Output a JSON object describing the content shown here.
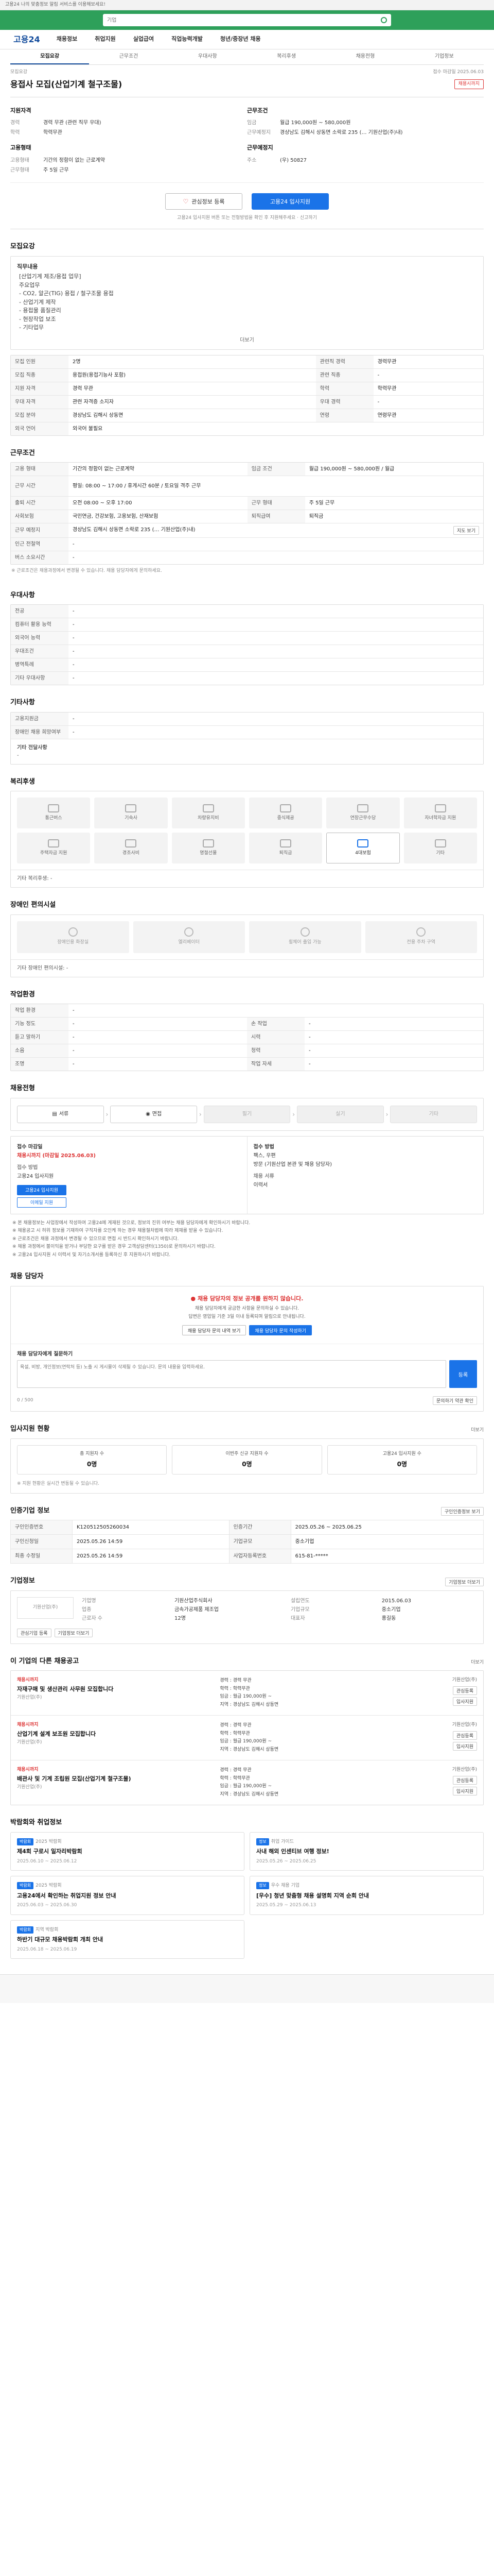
{
  "top_notice": "고용24 나의 맞춤정보 알림 서비스를 이용해보세요!",
  "search": {
    "placeholder": "기업"
  },
  "gnb": {
    "logo": "고용24",
    "items": [
      "채용정보",
      "취업지원",
      "실업급여",
      "직업능력개발",
      "청년/중장년 채용"
    ]
  },
  "tabs": [
    {
      "label": "모집요강",
      "active": true
    },
    {
      "label": "근무조건",
      "active": false
    },
    {
      "label": "우대사항",
      "active": false
    },
    {
      "label": "복리후생",
      "active": false
    },
    {
      "label": "채용전형",
      "active": false
    },
    {
      "label": "기업정보",
      "active": false
    }
  ],
  "header": {
    "meta_left": "모집요강",
    "meta_right": "접수 마감일 2025.06.03",
    "title": "용접사 모집(산업기계 철구조물)",
    "badge": "채용시까지"
  },
  "summary": {
    "left_head": "지원자격",
    "left_rows": [
      {
        "k": "경력",
        "v": "경력 무관 (관련 직무 우대)"
      },
      {
        "k": "학력",
        "v": "학력무관"
      }
    ],
    "left_head2": "고용형태",
    "left_rows2": [
      {
        "k": "고용형태",
        "v": "기간의 정함이 없는 근로계약"
      },
      {
        "k": "근무형태",
        "v": "주 5일 근무"
      }
    ],
    "right_head": "근무조건",
    "right_rows": [
      {
        "k": "임금",
        "v": "월급 190,000원 ~ 580,000원"
      },
      {
        "k": "근무예정지",
        "v": "경상남도 김해시 상동면 소락로 235 (… 기원산업(주)내)"
      }
    ],
    "right_head2": "근무예정지",
    "right_rows2": [
      {
        "k": "주소",
        "v": "(우) 50827"
      }
    ]
  },
  "actions": {
    "save": "관심정보 등록",
    "apply": "고용24 입사지원",
    "notice": "고용24 입사지원 버튼 또는 전형방법을 확인 후 지원해주세요 · 신고하기"
  },
  "recruit": {
    "title": "모집요강",
    "duties_head": "직무내용",
    "duties": [
      "[산업기계 제조/용접 업무]",
      "주요업무",
      "- CO2, 알곤(TIG) 용접 / 철구조물 용접",
      "- 산업기계 제작",
      "- 용접물 품질관리",
      "- 현장작업 보조",
      "- 기타업무"
    ],
    "duties_more": "더보기",
    "rows": [
      {
        "k": "모집 인원",
        "v": "2명",
        "k2": "관련직 경력",
        "v2": "경력무관"
      },
      {
        "k": "모집 직종",
        "v": "용접원(용접기능사 포함)",
        "k2": "관련 직종",
        "v2": "-"
      },
      {
        "k": "지원 자격",
        "v": "경력 무관",
        "k2": "학력",
        "v2": "학력무관"
      },
      {
        "k": "우대 자격",
        "v": "관련 자격증 소지자",
        "k2": "우대 경력",
        "v2": "-"
      },
      {
        "k": "모집 분야",
        "v": "경상남도 김해시 상동면",
        "k2": "연령",
        "v2": "연령무관"
      },
      {
        "k": "외국 언어",
        "v": "외국어 불필요",
        "k2": "",
        "v2": ""
      }
    ]
  },
  "work": {
    "title": "근무조건",
    "rows": [
      {
        "k": "고용 형태",
        "v": "기간의 정함이 없는 근로계약",
        "k2": "임금 조건",
        "v2": "월급 190,000원 ~ 580,000원 / 월급"
      },
      {
        "k": "근무 시간",
        "v": "평일: 08:00 ~ 17:00 / 휴게시간 60분 / 토요일 격주 근무",
        "k2": "",
        "v2": ""
      },
      {
        "k": "출퇴 시간",
        "v": "오전 08:00 ~ 오후 17:00",
        "k2": "근무 형태",
        "v2": "주 5일 근무"
      },
      {
        "k": "사회보험",
        "v": "국민연금, 건강보험, 고용보험, 산재보험",
        "k2": "퇴직급여",
        "v2": "퇴직금"
      },
      {
        "k": "근무 예정지",
        "v": "경상남도 김해시 상동면 소락로 235 (… 기원산업(주)내)",
        "k2": "",
        "v2": ""
      },
      {
        "k": "인근 전철역",
        "v": "-",
        "k2": "",
        "v2": ""
      },
      {
        "k": "버스 소요시간",
        "v": "-",
        "k2": "",
        "v2": ""
      }
    ],
    "map_btn": "지도 보기",
    "note": "※ 근로조건은 채용과정에서 변경될 수 있습니다. 채용 담당자에게 문의하세요."
  },
  "prefer": {
    "title": "우대사항",
    "rows": [
      {
        "k": "전공",
        "v": "-"
      },
      {
        "k": "컴퓨터 활용 능력",
        "v": "-"
      },
      {
        "k": "외국어 능력",
        "v": "-"
      },
      {
        "k": "우대조건",
        "v": "-"
      },
      {
        "k": "병역특례",
        "v": "-"
      },
      {
        "k": "기타 우대사항",
        "v": "-"
      }
    ]
  },
  "etc": {
    "title": "기타사항",
    "rows": [
      {
        "k": "고용지원금",
        "v": "-"
      },
      {
        "k": "장애인 채용 희망여부",
        "v": "-"
      }
    ],
    "extra_head": "기타 전달사항",
    "extra_val": "-"
  },
  "welfare": {
    "title": "복리후생",
    "items": [
      {
        "label": "통근버스",
        "on": false
      },
      {
        "label": "기숙사",
        "on": false
      },
      {
        "label": "차량유지비",
        "on": false
      },
      {
        "label": "중식제공",
        "on": false
      },
      {
        "label": "연장근무수당",
        "on": false
      },
      {
        "label": "자녀학자금 지원",
        "on": false
      },
      {
        "label": "주택자금 지원",
        "on": false
      },
      {
        "label": "경조사비",
        "on": false
      },
      {
        "label": "명절선물",
        "on": false
      },
      {
        "label": "퇴직금",
        "on": false
      },
      {
        "label": "4대보험",
        "on": true
      },
      {
        "label": "기타",
        "on": false
      }
    ],
    "note": "기타 복리후생: -"
  },
  "disability": {
    "title": "장애인 편의시설",
    "items": [
      "장애인용 화장실",
      "엘리베이터",
      "휠체어 출입 가능",
      "전용 주차 구역"
    ],
    "note": "기타 장애인 편의시설: -"
  },
  "worksite": {
    "title": "작업환경",
    "rows": [
      {
        "k": "작업 환경",
        "v": "-",
        "k2": "",
        "v2": ""
      },
      {
        "k": "기능 정도",
        "v": "-",
        "k2": "손 작업",
        "v2": "-"
      },
      {
        "k": "듣고 말하기",
        "v": "-",
        "k2": "시력",
        "v2": "-"
      },
      {
        "k": "소음",
        "v": "-",
        "k2": "청력",
        "v2": "-"
      },
      {
        "k": "조명",
        "v": "-",
        "k2": "작업 자세",
        "v2": "-"
      }
    ]
  },
  "process": {
    "title": "채용전형",
    "steps": [
      {
        "label": "서류",
        "off": false
      },
      {
        "label": "면접",
        "off": false
      },
      {
        "label": "필기",
        "off": true
      },
      {
        "label": "실기",
        "off": true
      },
      {
        "label": "기타",
        "off": true
      }
    ]
  },
  "apply_info": {
    "left_head": "접수 마감일",
    "left_red": "채용시까지 (마감일 2025.06.03)",
    "left_sub": "접수 방법",
    "left_methods": "고용24 입사지원",
    "btn_apply": "고용24 입사지원",
    "btn_mail": "이메일 지원",
    "right_head": "접수 방법",
    "right_lines": [
      "팩스, 우편",
      "방문 (기원산업 본관 및 채용 담당자)"
    ],
    "right_sub": "채용 서류",
    "right_docs": "이력서"
  },
  "bullets": [
    "※ 본 채용정보는 사업장에서 작성하여 고용24에 게재된 것으로, 정보의 진위 여부는 채용 담당자에게 확인하시기 바랍니다.",
    "※ 채용공고 시 허위 정보를 기재하여 구직자를 오인케 하는 경우 채용절차법에 따라 제재를 받을 수 있습니다.",
    "※ 근로조건은 채용 과정에서 변경될 수 있으므로 면접 시 반드시 확인하시기 바랍니다.",
    "※ 채용 과정에서 불이익을 받거나 부당한 요구를 받은 경우 고객상담센터(1350)로 문의하시기 바랍니다.",
    "※ 고용24 입사지원 시 이력서 및 자기소개서를 등록하신 후 지원하시기 바랍니다."
  ],
  "inquiry": {
    "title": "채용 담당자",
    "head": "채용 담당자의 정보 공개를 원하지 않습니다.",
    "lines": [
      "채용 담당자에게 궁금한 사항을 문의하실 수 있습니다.",
      "답변은 영업일 기준 3일 이내 등록되며 알림으로 안내됩니다."
    ],
    "btn_history": "채용 담당자 문의 내역 보기",
    "btn_inquiry": "채용 담당자 문의 작성하기",
    "form_label": "채용 담당자에게 질문하기",
    "placeholder": "욕설, 비방, 개인정보(연락처 등) 노출 시 게시물이 삭제될 수 있습니다. 문의 내용을 입력하세요.",
    "send": "등록",
    "counter": "0 / 500",
    "bottom_btn": "문의하기 약관 확인"
  },
  "stats": {
    "title": "입사지원 현황",
    "more": "더보기",
    "items": [
      {
        "label": "총 지원자 수",
        "value": "0명"
      },
      {
        "label": "이번주 신규 지원자 수",
        "value": "0명"
      },
      {
        "label": "고용24 입사지원 수",
        "value": "0명"
      }
    ],
    "note": "※ 지원 현황은 실시간 변동될 수 있습니다."
  },
  "jobinfo": {
    "title": "인증기업 정보",
    "more_btn": "구인인증정보 보기",
    "rows": [
      {
        "k": "구인인증번호",
        "v": "K120512505260034",
        "k2": "인증기간",
        "v2": "2025.05.26 ~ 2025.06.25"
      },
      {
        "k": "구인신청일",
        "v": "2025.05.26 14:59",
        "k2": "기업규모",
        "v2": "중소기업"
      },
      {
        "k": "최종 수정일",
        "v": "2025.05.26 14:59",
        "k2": "사업자등록번호",
        "v2": "615-81-*****"
      }
    ]
  },
  "company": {
    "title": "기업정보",
    "more": "기업정보 더보기",
    "logo_text": "기원산업(주)",
    "fields": [
      {
        "k": "기업명",
        "v": "기원산업주식회사"
      },
      {
        "k": "설립연도",
        "v": "2015.06.03"
      },
      {
        "k": "업종",
        "v": "금속가공제품 제조업"
      },
      {
        "k": "기업규모",
        "v": "중소기업"
      },
      {
        "k": "근로자 수",
        "v": "12명"
      },
      {
        "k": "대표자",
        "v": "홍길동"
      }
    ],
    "btn_interest": "관심기업 등록",
    "btn_more": "기업정보 더보기"
  },
  "related": {
    "title": "이 기업의 다른 채용공고",
    "more": "더보기",
    "items": [
      {
        "dday": "채용시까지",
        "title": "자재구매 및 생산관리 사무원 모집합니다",
        "company": "기원산업(주)",
        "lines": [
          "경력 : 경력 무관",
          "학력 : 학력무관",
          "임금 : 월급 190,000원 ~",
          "지역 : 경상남도 김해시 상동면"
        ],
        "logo": "기원산업(주)"
      },
      {
        "dday": "채용시까지",
        "title": "산업기계 설계 보조원 모집합니다",
        "company": "기원산업(주)",
        "lines": [
          "경력 : 경력 무관",
          "학력 : 학력무관",
          "임금 : 월급 190,000원 ~",
          "지역 : 경상남도 김해시 상동면"
        ],
        "logo": "기원산업(주)"
      },
      {
        "dday": "채용시까지",
        "title": "배관사 및 기계 조립원 모집(산업기계 철구조물)",
        "company": "기원산업(주)",
        "lines": [
          "경력 : 경력 무관",
          "학력 : 학력무관",
          "임금 : 월급 190,000원 ~",
          "지역 : 경상남도 김해시 상동면"
        ],
        "logo": "기원산업(주)"
      }
    ],
    "btn_save": "관심등록",
    "btn_apply": "입사지원"
  },
  "news": {
    "title": "박람회와 취업정보",
    "items": [
      {
        "tag": "박람회",
        "src": "2025 박람회",
        "title": "제4회 구로시 일자리박람회",
        "date": "2025.06.10 ~ 2025.06.12"
      },
      {
        "tag": "정보",
        "src": "취업 가이드",
        "title": "사내 해외 인센티브 여행 정보!",
        "date": "2025.05.26 ~ 2025.06.25"
      },
      {
        "tag": "박람회",
        "src": "2025 박람회",
        "title": "고용24에서 확인하는 취업지원 정보 안내",
        "date": "2025.06.03 ~ 2025.06.30"
      },
      {
        "tag": "정보",
        "src": "우수 채용 기업",
        "title": "[우수] 청년 맞춤형 채용 설명회 지역 순회 안내",
        "date": "2025.05.29 ~ 2025.06.13"
      },
      {
        "tag": "박람회",
        "src": "지역 박람회",
        "title": "하반기 대규모 채용박람회 개최 안내",
        "date": "2025.06.18 ~ 2025.06.19"
      }
    ]
  }
}
